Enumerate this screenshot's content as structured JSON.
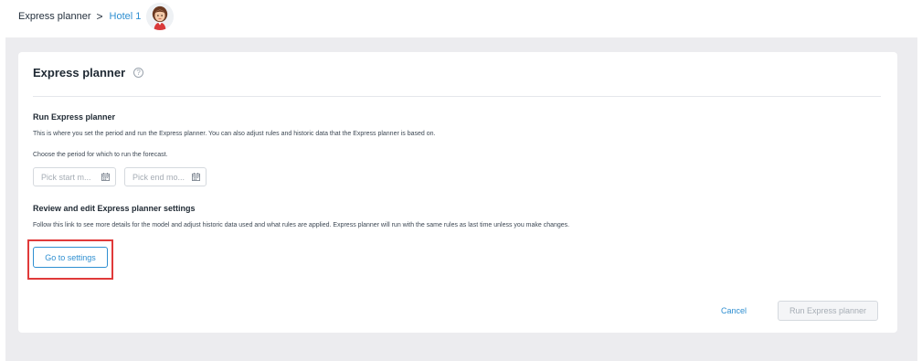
{
  "breadcrumb": {
    "root": "Express planner",
    "separator": ">",
    "current": "Hotel 1"
  },
  "card": {
    "title": "Express planner",
    "help_icon": "?",
    "run_section": {
      "heading": "Run Express planner",
      "description": "This is where you set the period and run the Express planner. You can also adjust rules and historic data that the Express planner is based on.",
      "period_label": "Choose the period for which to run the forecast.",
      "start_placeholder": "Pick start m...",
      "end_placeholder": "Pick end mo..."
    },
    "settings_section": {
      "heading": "Review and edit Express planner settings",
      "description": "Follow this link to see more details for the model and adjust historic data used and what rules are applied. Express planner will run with the same rules as last time unless you make changes.",
      "button_label": "Go to settings"
    },
    "footer": {
      "cancel_label": "Cancel",
      "run_label": "Run Express planner"
    }
  },
  "colors": {
    "accent": "#2f8fd1",
    "highlight": "#e03a3a",
    "canvas": "#ececef"
  }
}
